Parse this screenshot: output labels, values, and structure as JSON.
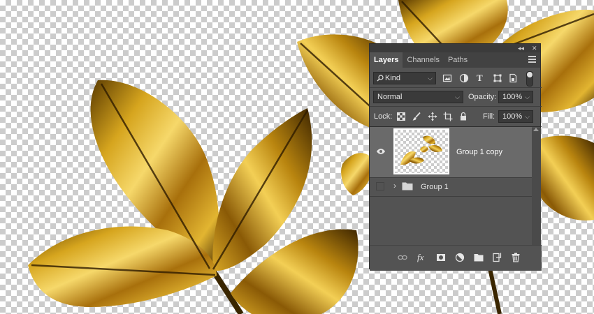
{
  "canvas": {
    "background": "transparent-checkerboard",
    "leaf_color": "#c9a01a"
  },
  "panel": {
    "controls": {
      "collapse": "◂◂",
      "close": "✕"
    },
    "tabs": [
      {
        "label": "Layers",
        "active": true
      },
      {
        "label": "Channels",
        "active": false
      },
      {
        "label": "Paths",
        "active": false
      }
    ],
    "filter": {
      "value": "Kind"
    },
    "blend_mode": {
      "value": "Normal"
    },
    "opacity": {
      "label": "Opacity:",
      "value": "100%"
    },
    "lock": {
      "label": "Lock:"
    },
    "fill": {
      "label": "Fill:",
      "value": "100%"
    },
    "layers": [
      {
        "name": "Group 1 copy",
        "visible": true,
        "selected": true,
        "type": "layer"
      },
      {
        "name": "Group 1",
        "visible": false,
        "selected": false,
        "type": "group"
      }
    ],
    "footer_icons": [
      "link-icon",
      "fx-icon",
      "add-mask-icon",
      "adjustment-icon",
      "new-group-icon",
      "new-layer-icon",
      "trash-icon"
    ]
  }
}
